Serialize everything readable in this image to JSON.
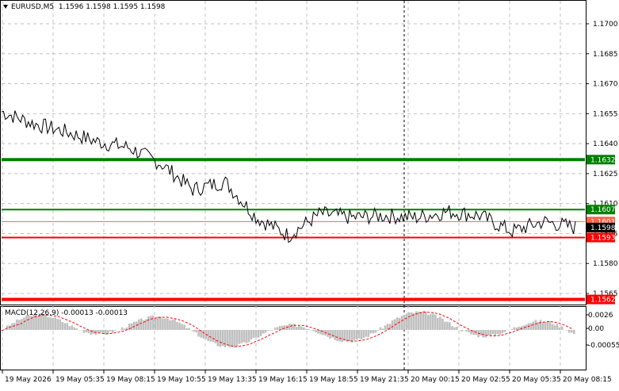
{
  "header": {
    "symbol": "EURUSD,M5",
    "ohlc": "1.1596 1.1598 1.1595 1.1598"
  },
  "macd": {
    "label": "MACD(12,26,9)",
    "values": "-0.00013 -0.00013",
    "axis_labels": [
      "0.0026",
      "0.00",
      "-0.00055"
    ]
  },
  "price_axis": {
    "ticks": [
      "1.1700",
      "1.1685",
      "1.1670",
      "1.1655",
      "1.1640",
      "1.1625",
      "1.1610",
      "1.1595",
      "1.1580",
      "1.1565"
    ]
  },
  "levels": [
    {
      "name": "green-upper",
      "price": "1.1632",
      "color": "#008000"
    },
    {
      "name": "green-lower",
      "price": "1.1607",
      "color": "#008000"
    },
    {
      "name": "red-upper-thin",
      "price": "1.1601",
      "color": "#ff6347"
    },
    {
      "name": "current",
      "price": "1.1598",
      "color": "#000000"
    },
    {
      "name": "red-mid",
      "price": "1.1593",
      "color": "#ff0000"
    },
    {
      "name": "red-lower",
      "price": "1.1562",
      "color": "#ff0000"
    }
  ],
  "time_axis": {
    "labels": [
      "19 May 2026",
      "19 May 05:35",
      "19 May 08:15",
      "19 May 10:55",
      "19 May 13:35",
      "19 May 16:15",
      "19 May 18:55",
      "19 May 21:35",
      "20 May 00:15",
      "20 May 02:55",
      "20 May 05:35",
      "20 May 08:15"
    ]
  },
  "chart_data": {
    "type": "line",
    "title": "EURUSD,M5",
    "ylim": [
      1.1555,
      1.171
    ],
    "x": [
      "19 May 2026",
      "19 May 05:35",
      "19 May 08:15",
      "19 May 10:55",
      "19 May 13:35",
      "19 May 16:15",
      "19 May 18:55",
      "19 May 21:35",
      "20 May 00:15",
      "20 May 02:55",
      "20 May 05:35",
      "20 May 08:15"
    ],
    "series": [
      {
        "values": [
          1.1656,
          1.165,
          1.1646,
          1.1641,
          1.1638,
          1.163,
          1.1617,
          1.1621,
          1.1603,
          1.1594,
          1.1605,
          1.1603,
          1.1604,
          1.1603,
          1.1606,
          1.1604,
          1.1596,
          1.1601,
          1.1598
        ]
      }
    ]
  }
}
